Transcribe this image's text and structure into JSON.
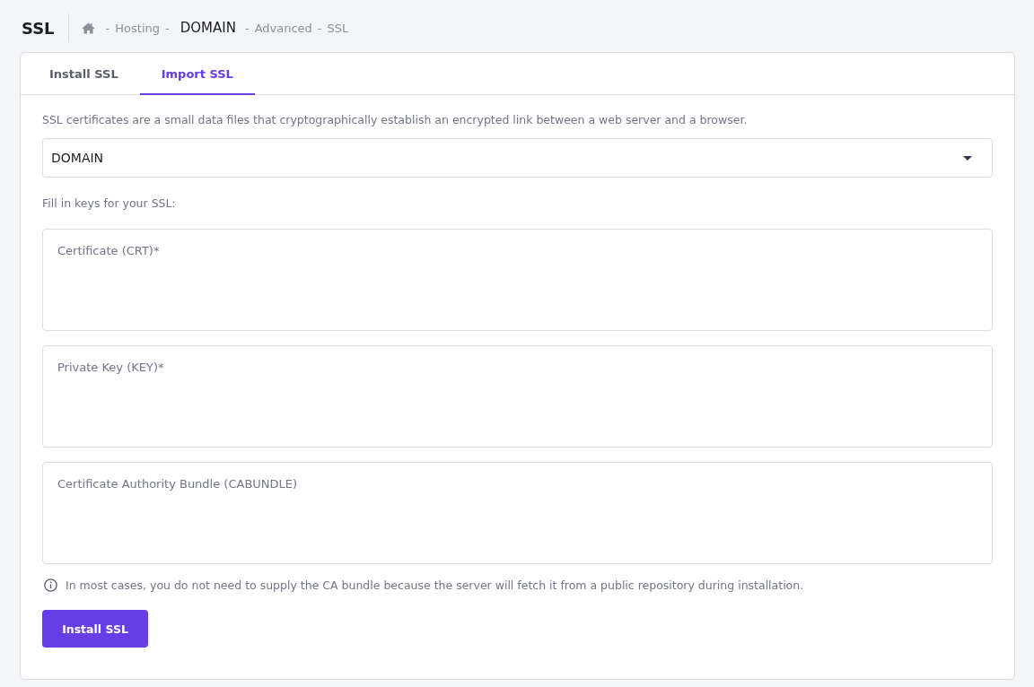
{
  "page_title": "SSL",
  "breadcrumb": [
    {
      "kind": "home"
    },
    {
      "kind": "separator",
      "text": "-"
    },
    {
      "kind": "link",
      "text": "Hosting"
    },
    {
      "kind": "separator",
      "text": "-"
    },
    {
      "kind": "current",
      "text": "DOMAIN"
    },
    {
      "kind": "separator",
      "text": "-"
    },
    {
      "kind": "link",
      "text": "Advanced"
    },
    {
      "kind": "separator",
      "text": "-"
    },
    {
      "kind": "link",
      "text": "SSL"
    }
  ],
  "tabs": [
    {
      "label": "Install SSL",
      "selected": false
    },
    {
      "label": "Import SSL",
      "selected": true
    }
  ],
  "description": "SSL certificates are a small data files that cryptographically establish an encrypted link between a web server and a browser.",
  "domain_select": {
    "value": "DOMAIN"
  },
  "keys_label": "Fill in keys for your SSL:",
  "key_fields": [
    {
      "placeholder": "Certificate (CRT)*"
    },
    {
      "placeholder": "Private Key (KEY)*"
    },
    {
      "placeholder": "Certificate Authority Bundle (CABUNDLE)"
    }
  ],
  "info_note": "In most cases, you do not need to supply the CA bundle because the server will fetch it from a public repository during installation.",
  "submit_button": "Install SSL"
}
